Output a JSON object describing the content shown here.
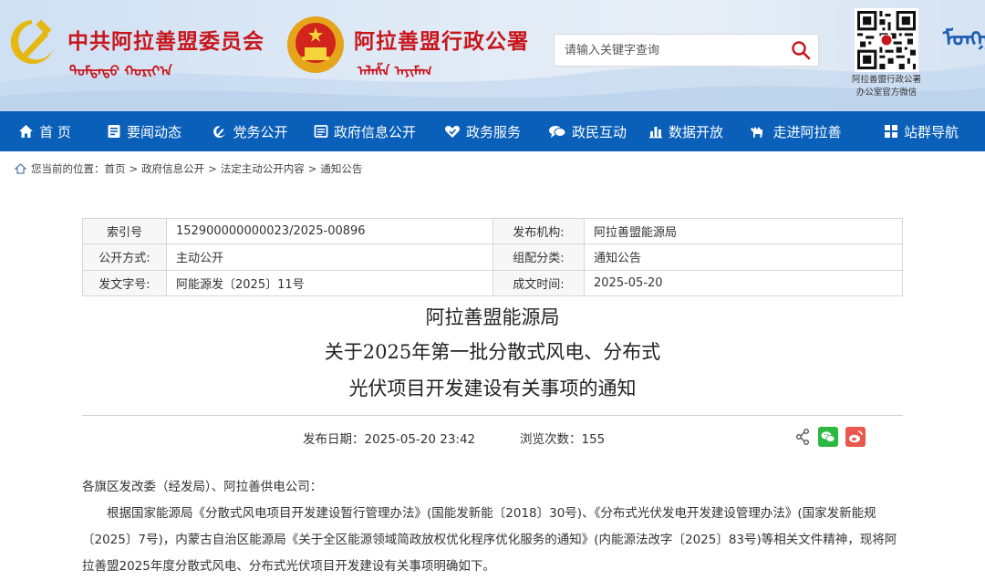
{
  "header": {
    "party_name": "中共阿拉善盟委员会",
    "gov_name": "阿拉善盟行政公署",
    "mongol_script_1": "ᠳᠤᠮᠳᠠᠳᠤ ᠬᠣᠷᠢᠶ᠎ᠠ",
    "mongol_script_2": "ᠠᠯᠠᠱᠠ ᠠᠶᠢᠮᠠᠭ",
    "search_placeholder": "请输入关键字查询",
    "qr_caption_1": "阿拉善盟行政公署",
    "qr_caption_2": "办公室官方微信",
    "side_mongol": "ᠮᠣᠩᠭᠣᠯ"
  },
  "nav": {
    "items": [
      {
        "label": "首 页",
        "icon": "home-icon"
      },
      {
        "label": "要闻动态",
        "icon": "news-icon"
      },
      {
        "label": "党务公开",
        "icon": "party-icon"
      },
      {
        "label": "政府信息公开",
        "icon": "gov-info-icon"
      },
      {
        "label": "政务服务",
        "icon": "service-icon"
      },
      {
        "label": "政民互动",
        "icon": "chat-icon"
      },
      {
        "label": "数据开放",
        "icon": "data-icon"
      },
      {
        "label": "走进阿拉善",
        "icon": "camel-icon"
      },
      {
        "label": "站群导航",
        "icon": "grid-icon"
      }
    ]
  },
  "breadcrumb": {
    "prefix": "您当前的位置：",
    "items": [
      "首页",
      "政府信息公开",
      "法定主动公开内容",
      "通知公告"
    ]
  },
  "meta": {
    "index_label": "索引号",
    "index_value": "152900000000023/2025-00896",
    "publisher_label": "发布机构:",
    "publisher_value": "阿拉善盟能源局",
    "open_label": "公开方式:",
    "open_value": "主动公开",
    "category_label": "组配分类:",
    "category_value": "通知公告",
    "docno_label": "发文字号:",
    "docno_value": "阿能源发〔2025〕11号",
    "date_label": "成文时间:",
    "date_value": "2025-05-20"
  },
  "article": {
    "title_line1": "阿拉善盟能源局",
    "title_line2": "关于2025年第一批分散式风电、分布式",
    "title_line3": "光伏项目开发建设有关事项的通知",
    "publish_date": "发布日期：2025-05-20 23:42",
    "views_label": "浏览次数：",
    "views_value": "155",
    "salutation": "各旗区发改委（经发局）、阿拉善供电公司：",
    "paragraph1": "根据国家能源局《分散式风电项目开发建设暂行管理办法》(国能发新能〔2018〕30号)、《分布式光伏发电开发建设管理办法》(国家发新能规〔2025〕7号)，内蒙古自治区能源局《关于全区能源领域简政放权优化程序优化服务的通知》(内能源法改字〔2025〕83号)等相关文件精神，现将阿拉善盟2025年度分散式风电、分布式光伏项目开发建设有关事项明确如下。"
  },
  "colors": {
    "brand_red": "#c8161d",
    "nav_blue": "#0a5fb9",
    "wechat_green": "#2cb941",
    "weibo_red": "#e9584c"
  }
}
